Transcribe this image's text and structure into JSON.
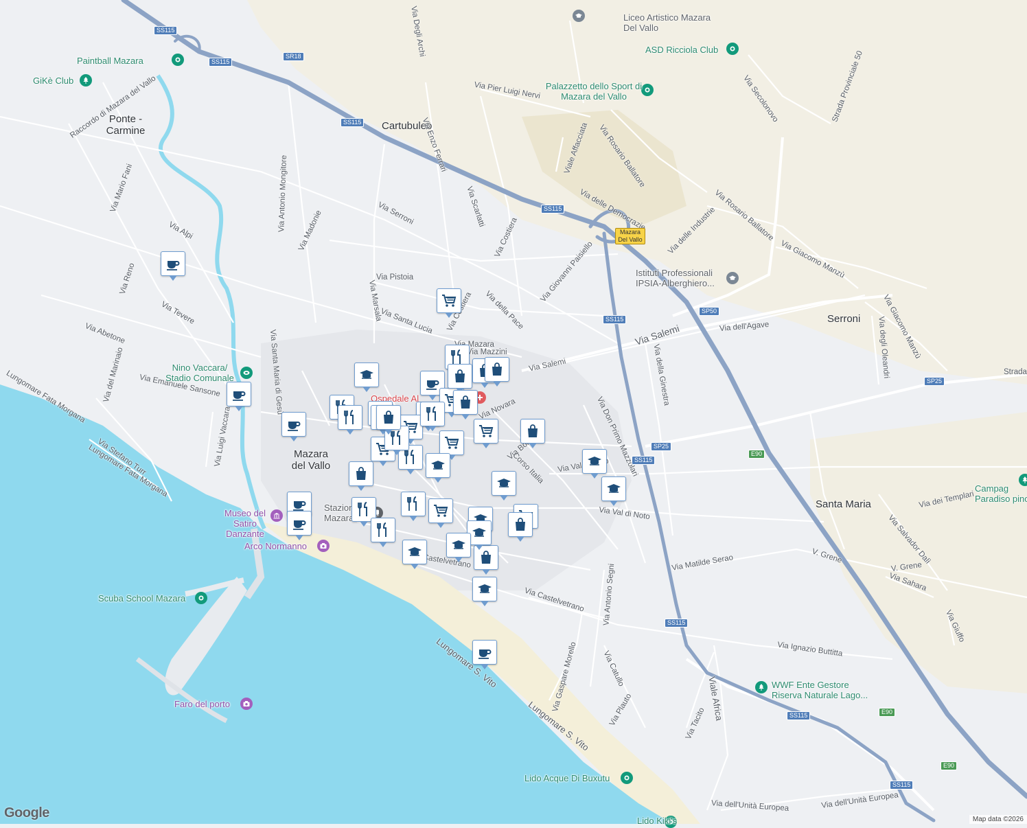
{
  "map": {
    "colors": {
      "land": "#eef0f3",
      "water": "#8fd9ee",
      "highway": "#8ca3c5",
      "urban": "#e3e5e9",
      "green": "#f2efe4",
      "beach": "#f4efd9"
    }
  },
  "places": [
    "Ponte - Carmine",
    "Cartubuleo",
    "Mazara del Vallo",
    "Serroni",
    "Santa Maria"
  ],
  "streets": [
    "Via Degli Archi",
    "Via Pier Luigi Nervi",
    "Via Enzo Ferrari",
    "Via Secolonovo",
    "Strada Provinciale 50",
    "Via Rosario Ballatore",
    "Viale Affacciata",
    "Raccordo di Mazara del Vallo",
    "Via Mario Fani",
    "Via Antonio Mongitore",
    "Via Madonie",
    "Via Serroni",
    "Via Scarlatti",
    "Via delle Democrazie",
    "Via Rosario Ballatore",
    "Via delle Industrie",
    "Via Giacomo Manzù",
    "Via Alpi",
    "Via Costiera",
    "Via Giovanni Paisiello",
    "Via Reno",
    "Via Pistoia",
    "Via Marsala",
    "Via Costiera",
    "Via della Pace",
    "Via Santa Lucia",
    "Via Tevere",
    "Via Salemi",
    "Via dell'Agave",
    "Via Giacomo Manzù",
    "Via degli Oleandri",
    "Via Abetone",
    "Via Mazzini",
    "Via Salemi",
    "Via della Ginestra",
    "Strada",
    "Via del Marinaio",
    "Via Emanuele Sansone",
    "Via Santa Maria di Gesù",
    "Lungomare Fata Morgana",
    "Via Luigi Vaccara",
    "Via Don Primo Mazzolari",
    "Via Novara",
    "Via Bolzano",
    "Corso Italia",
    "Via Stefano Turr",
    "Lungomare Fata Morgana",
    "Via Val di Noto",
    "Via Val di Noto",
    "Via dei Templari",
    "Via Salvador Dalì",
    "V. Grene",
    "V. Grene",
    "Via Sahara",
    "Via Matilde Serao",
    "Via Castelvetrano",
    "Via Castelvetrano",
    "Via Antonio Segni",
    "Via Giuffo",
    "Via Ignazio Buttitta",
    "Via Catullo",
    "Lungomare S. Vito",
    "Lungomare S. Vito",
    "Via Gaspare Morello",
    "Via Plauto",
    "Via Tacito",
    "Viale Africa",
    "Via dell'Unità Europea",
    "Via dell'Unità Europea",
    "Via Mazara"
  ],
  "shields": [
    "SS115",
    "SS115",
    "SR18",
    "SS115",
    "SS115",
    "Mazara Del Vallo",
    "SS115",
    "SP50",
    "SP25",
    "SP25",
    "SS115",
    "E90",
    "SS115",
    "SS115",
    "E90",
    "E90",
    "SS115"
  ],
  "pois": [
    {
      "name": "Liceo Artistico Mazara Del Vallo",
      "icon": "school-icon",
      "color": "#7b8794"
    },
    {
      "name": "ASD Ricciola Club",
      "icon": "sports-icon",
      "color": "#129a7b"
    },
    {
      "name": "Paintball Mazara",
      "icon": "sports-icon",
      "color": "#129a7b"
    },
    {
      "name": "GiKè Club",
      "icon": "tree-icon",
      "color": "#129a7b"
    },
    {
      "name": "Palazzetto dello Sport di Mazara del Vallo",
      "icon": "sports-icon",
      "color": "#129a7b"
    },
    {
      "name": "Istituti Professionali IPSIA-Alberghiero...",
      "icon": "school-icon",
      "color": "#7b8794"
    },
    {
      "name": "Nino Vaccara/ Stadio Comunale",
      "icon": "stadium-icon",
      "color": "#129a7b"
    },
    {
      "name": "Ospedale Al",
      "icon": "hospital-icon",
      "color": "#e05a5e"
    },
    {
      "name": "Campag Paradiso pino",
      "icon": "tree-icon",
      "color": "#129a7b"
    },
    {
      "name": "Museo del Satiro Danzante",
      "icon": "museum-icon",
      "color": "#a35fbd"
    },
    {
      "name": "Stazion Mazara del V",
      "icon": "train-icon",
      "color": "#5f6368"
    },
    {
      "name": "Arco Normanno",
      "icon": "camera-icon",
      "color": "#a35fbd"
    },
    {
      "name": "Scuba School Mazara",
      "icon": "sports-icon",
      "color": "#129a7b"
    },
    {
      "name": "Faro del porto",
      "icon": "camera-icon",
      "color": "#a35fbd"
    },
    {
      "name": "WWF Ente Gestore Riserva Naturale Lago...",
      "icon": "tree-icon",
      "color": "#129a7b"
    },
    {
      "name": "Lido Acque Di Buxutu",
      "icon": "sports-icon",
      "color": "#129a7b"
    },
    {
      "name": "Lido Kiki's",
      "icon": "sports-icon",
      "color": "#129a7b"
    }
  ],
  "markers": [
    "cafe-icon",
    "cafe-icon",
    "cafe-icon",
    "cafe-icon",
    "cafe-icon",
    "cafe-icon",
    "cafe-icon",
    "cart-icon",
    "cart-icon",
    "cart-icon",
    "cart-icon",
    "cart-icon",
    "cart-icon",
    "cart-icon",
    "cart-icon",
    "cart-icon",
    "restaurant-icon",
    "restaurant-icon",
    "restaurant-icon",
    "restaurant-icon",
    "restaurant-icon",
    "restaurant-icon",
    "restaurant-icon",
    "restaurant-icon",
    "restaurant-icon",
    "restaurant-icon",
    "bag-icon",
    "bag-icon",
    "bag-icon",
    "bag-icon",
    "bag-icon",
    "bag-icon",
    "bag-icon",
    "bag-icon",
    "bag-icon",
    "bag-icon",
    "school-icon",
    "school-icon",
    "school-icon",
    "school-icon",
    "school-icon",
    "school-icon",
    "school-icon",
    "school-icon",
    "school-icon",
    "school-icon"
  ],
  "branding": {
    "google": "Google",
    "attribution": "Map data ©2026"
  }
}
